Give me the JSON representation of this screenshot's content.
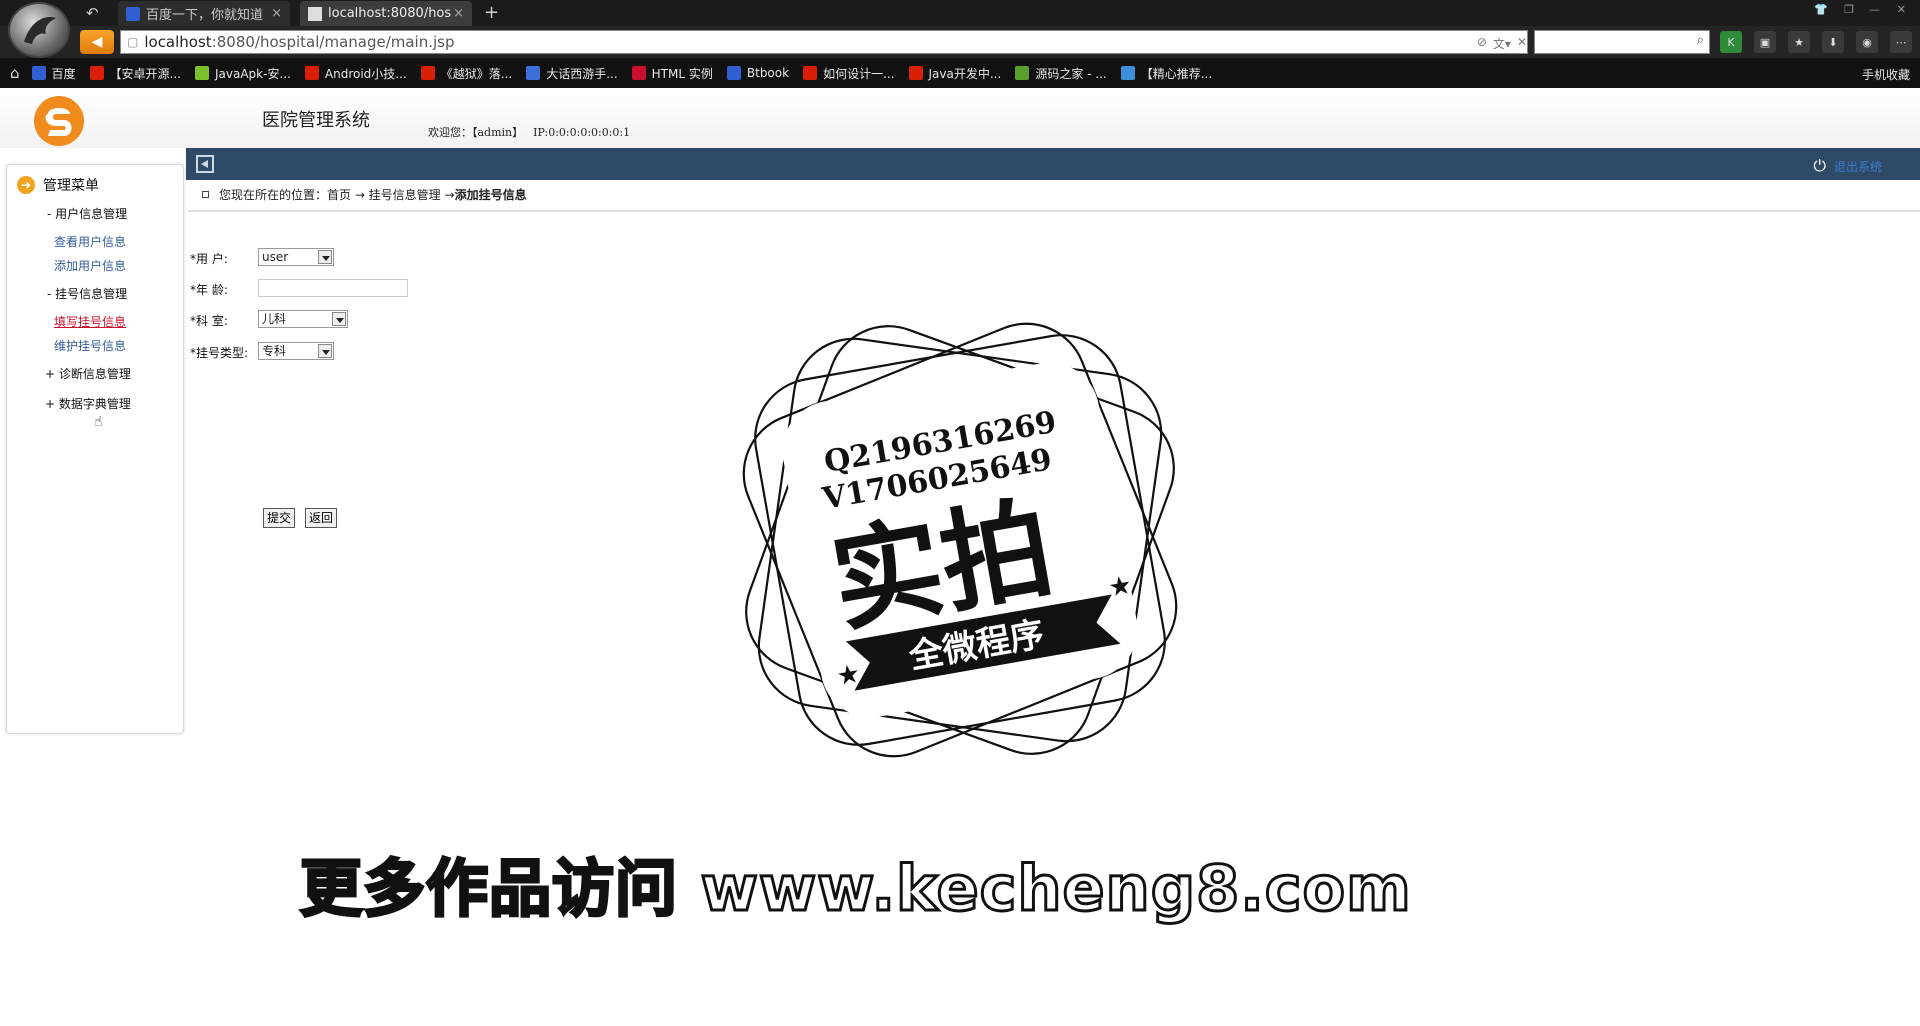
{
  "browser": {
    "tabs": [
      {
        "title": "百度一下，你就知道",
        "close": "×"
      },
      {
        "title": "localhost:8080/hos",
        "close": "×"
      }
    ],
    "new_tab": "+",
    "url_host": "localhost",
    "url_path": ":8080/hospital/manage/main.jsp",
    "bookmarks": [
      {
        "label": "百度",
        "icon_color": "#2f5fd0"
      },
      {
        "label": "【安卓开源...",
        "icon_color": "#d81e06"
      },
      {
        "label": "JavaApk-安...",
        "icon_color": "#7bbf2b"
      },
      {
        "label": "Android小技...",
        "icon_color": "#d81e06"
      },
      {
        "label": "《越狱》落...",
        "icon_color": "#d81e06"
      },
      {
        "label": "大话西游手...",
        "icon_color": "#3c6fd8"
      },
      {
        "label": "HTML 实例",
        "icon_color": "#c8102e"
      },
      {
        "label": "Btbook",
        "icon_color": "#2f5fd0"
      },
      {
        "label": "如何设计一...",
        "icon_color": "#d81e06"
      },
      {
        "label": "Java开发中...",
        "icon_color": "#d81e06"
      },
      {
        "label": "源码之家 - ...",
        "icon_color": "#5aa02c"
      },
      {
        "label": "【精心推荐...",
        "icon_color": "#3c8fd8"
      }
    ],
    "mobile_fav": "手机收藏"
  },
  "app": {
    "title": "医院管理系统",
    "welcome": "欢迎您：【admin】",
    "ip": "IP:0:0:0:0:0:0:0:1",
    "logout": "退出系统"
  },
  "sidebar": {
    "header": "管理菜单",
    "groups": [
      {
        "label": "- 用户信息管理",
        "items": [
          "查看用户信息",
          "添加用户信息"
        ]
      },
      {
        "label": "- 挂号信息管理",
        "items": [
          "填写挂号信息",
          "维护挂号信息"
        ]
      },
      {
        "label": "+ 诊断信息管理",
        "items": []
      },
      {
        "label": "+ 数据字典管理",
        "items": []
      }
    ]
  },
  "breadcrumb": {
    "prefix": "您现在所在的位置：首页 → 挂号信息管理 → ",
    "current": "添加挂号信息"
  },
  "form": {
    "user_label": "*用  户:",
    "user_value": "user",
    "age_label": "*年  龄:",
    "age_value": "",
    "dept_label": "*科  室:",
    "dept_value": "儿科",
    "type_label": "*挂号类型:",
    "type_value": "专科",
    "submit": "提交",
    "back": "返回"
  },
  "watermark": {
    "q": "Q2196316269",
    "v": "V1706025649",
    "big": "实拍",
    "banner": "全微程序",
    "footer": "更多作品访问 www.kecheng8.com"
  }
}
